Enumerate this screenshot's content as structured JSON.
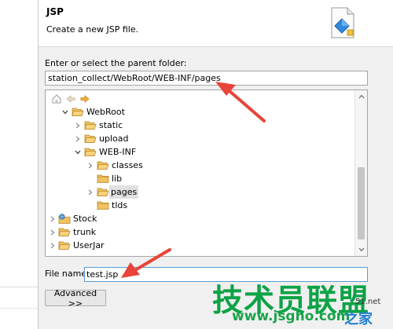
{
  "header": {
    "title": "JSP",
    "description": "Create a new JSP file.",
    "icon": "jsp-wizard-icon"
  },
  "parent_folder": {
    "label": "Enter or select the parent folder:",
    "value": "station_collect/WebRoot/WEB-INF/pages"
  },
  "tree": {
    "toolbar": [
      "home-icon",
      "back-icon",
      "forward-icon"
    ],
    "rows": [
      {
        "label": "WebRoot",
        "level": 0,
        "expanded": true,
        "type": "folder"
      },
      {
        "label": "static",
        "level": 1,
        "expanded": false,
        "type": "folder"
      },
      {
        "label": "upload",
        "level": 1,
        "expanded": false,
        "type": "folder"
      },
      {
        "label": "WEB-INF",
        "level": 1,
        "expanded": true,
        "type": "folder"
      },
      {
        "label": "classes",
        "level": 2,
        "expanded": false,
        "type": "folder"
      },
      {
        "label": "lib",
        "level": 2,
        "expanded": null,
        "type": "folder"
      },
      {
        "label": "pages",
        "level": 2,
        "expanded": false,
        "type": "folder",
        "selected": true
      },
      {
        "label": "tlds",
        "level": 2,
        "expanded": null,
        "type": "folder"
      },
      {
        "label": "Stock",
        "level": -1,
        "expanded": false,
        "type": "project"
      },
      {
        "label": "trunk",
        "level": -1,
        "expanded": false,
        "type": "project"
      },
      {
        "label": "UserJar",
        "level": -1,
        "expanded": false,
        "type": "project"
      }
    ]
  },
  "file_name": {
    "label": "File name:",
    "value": "test.jsp"
  },
  "advanced_button": "Advanced >>",
  "watermark": {
    "main": "技术员联盟",
    "url": "www.jsgho.com",
    "home": "之家",
    "small": "51.net"
  },
  "colors": {
    "arrow": "#e8443a",
    "folder": "#e8b64c",
    "watermark_green": "#0da346"
  }
}
